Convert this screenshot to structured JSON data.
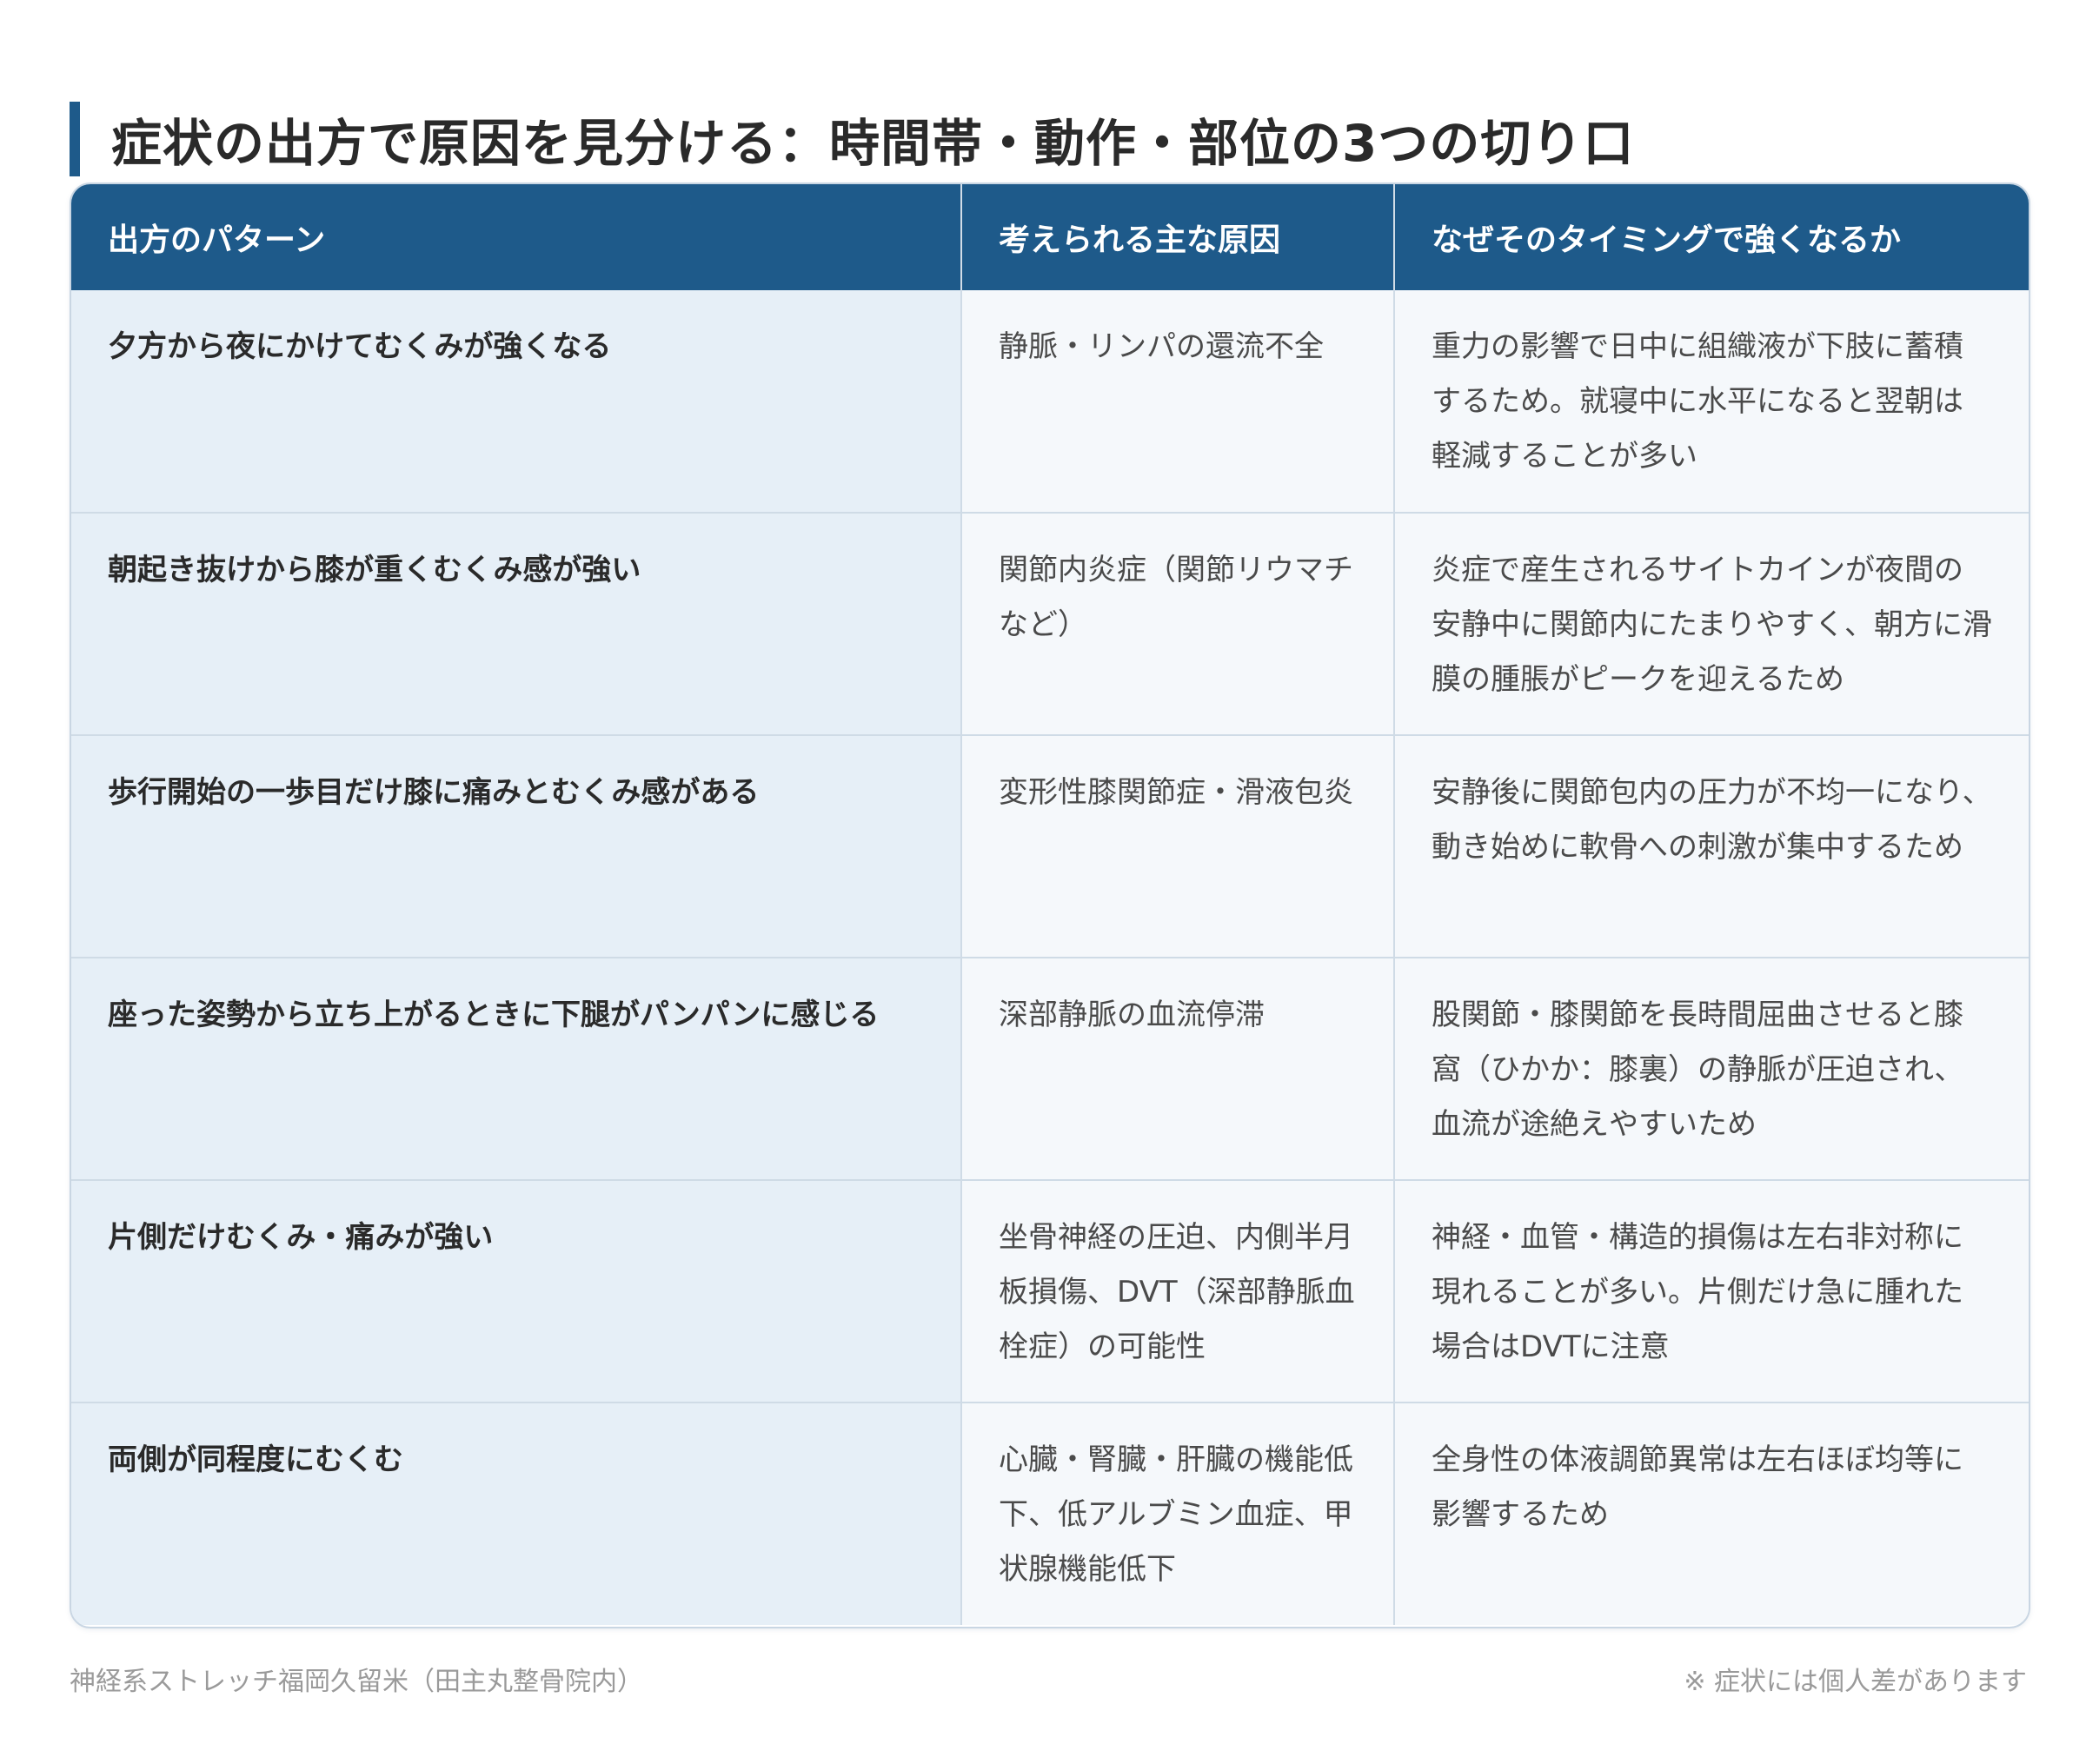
{
  "title": "症状の出方で原因を見分ける：時間帯・動作・部位の3つの切り口",
  "table": {
    "headers": [
      "出方のパターン",
      "考えられる主な原因",
      "なぜそのタイミングで強くなるか"
    ],
    "rows": [
      {
        "pattern": "夕方から夜にかけてむくみが強くなる",
        "cause": "静脈・リンパの還流不全",
        "reason": "重力の影響で日中に組織液が下肢に蓄積するため。就寝中に水平になると翌朝は軽減することが多い"
      },
      {
        "pattern": "朝起き抜けから膝が重くむくみ感が強い",
        "cause": "関節内炎症（関節リウマチなど）",
        "reason": "炎症で産生されるサイトカインが夜間の安静中に関節内にたまりやすく、朝方に滑膜の腫脹がピークを迎えるため"
      },
      {
        "pattern": "歩行開始の一歩目だけ膝に痛みとむくみ感がある",
        "cause": "変形性膝関節症・滑液包炎",
        "reason": "安静後に関節包内の圧力が不均一になり、動き始めに軟骨への刺激が集中するため"
      },
      {
        "pattern": "座った姿勢から立ち上がるときに下腿がパンパンに感じる",
        "cause": "深部静脈の血流停滞",
        "reason": "股関節・膝関節を長時間屈曲させると膝窩（ひかか：膝裏）の静脈が圧迫され、血流が途絶えやすいため"
      },
      {
        "pattern": "片側だけむくみ・痛みが強い",
        "cause": "坐骨神経の圧迫、内側半月板損傷、DVT（深部静脈血栓症）の可能性",
        "reason": "神経・血管・構造的損傷は左右非対称に現れることが多い。片側だけ急に腫れた場合はDVTに注意"
      },
      {
        "pattern": "両側が同程度にむくむ",
        "cause": "心臓・腎臓・肝臓の機能低下、低アルブミン血症、甲状腺機能低下",
        "reason": "全身性の体液調節異常は左右ほぼ均等に影響するため"
      }
    ]
  },
  "footer": {
    "source": "神経系ストレッチ福岡久留米（田主丸整骨院内）",
    "note": "※ 症状には個人差があります"
  },
  "colors": {
    "header_bg": "#1e5a8a",
    "accent_bar": "#1e5a8a",
    "pattern_bg": "#e6eff7",
    "cell_bg": "#f5f8fb"
  }
}
